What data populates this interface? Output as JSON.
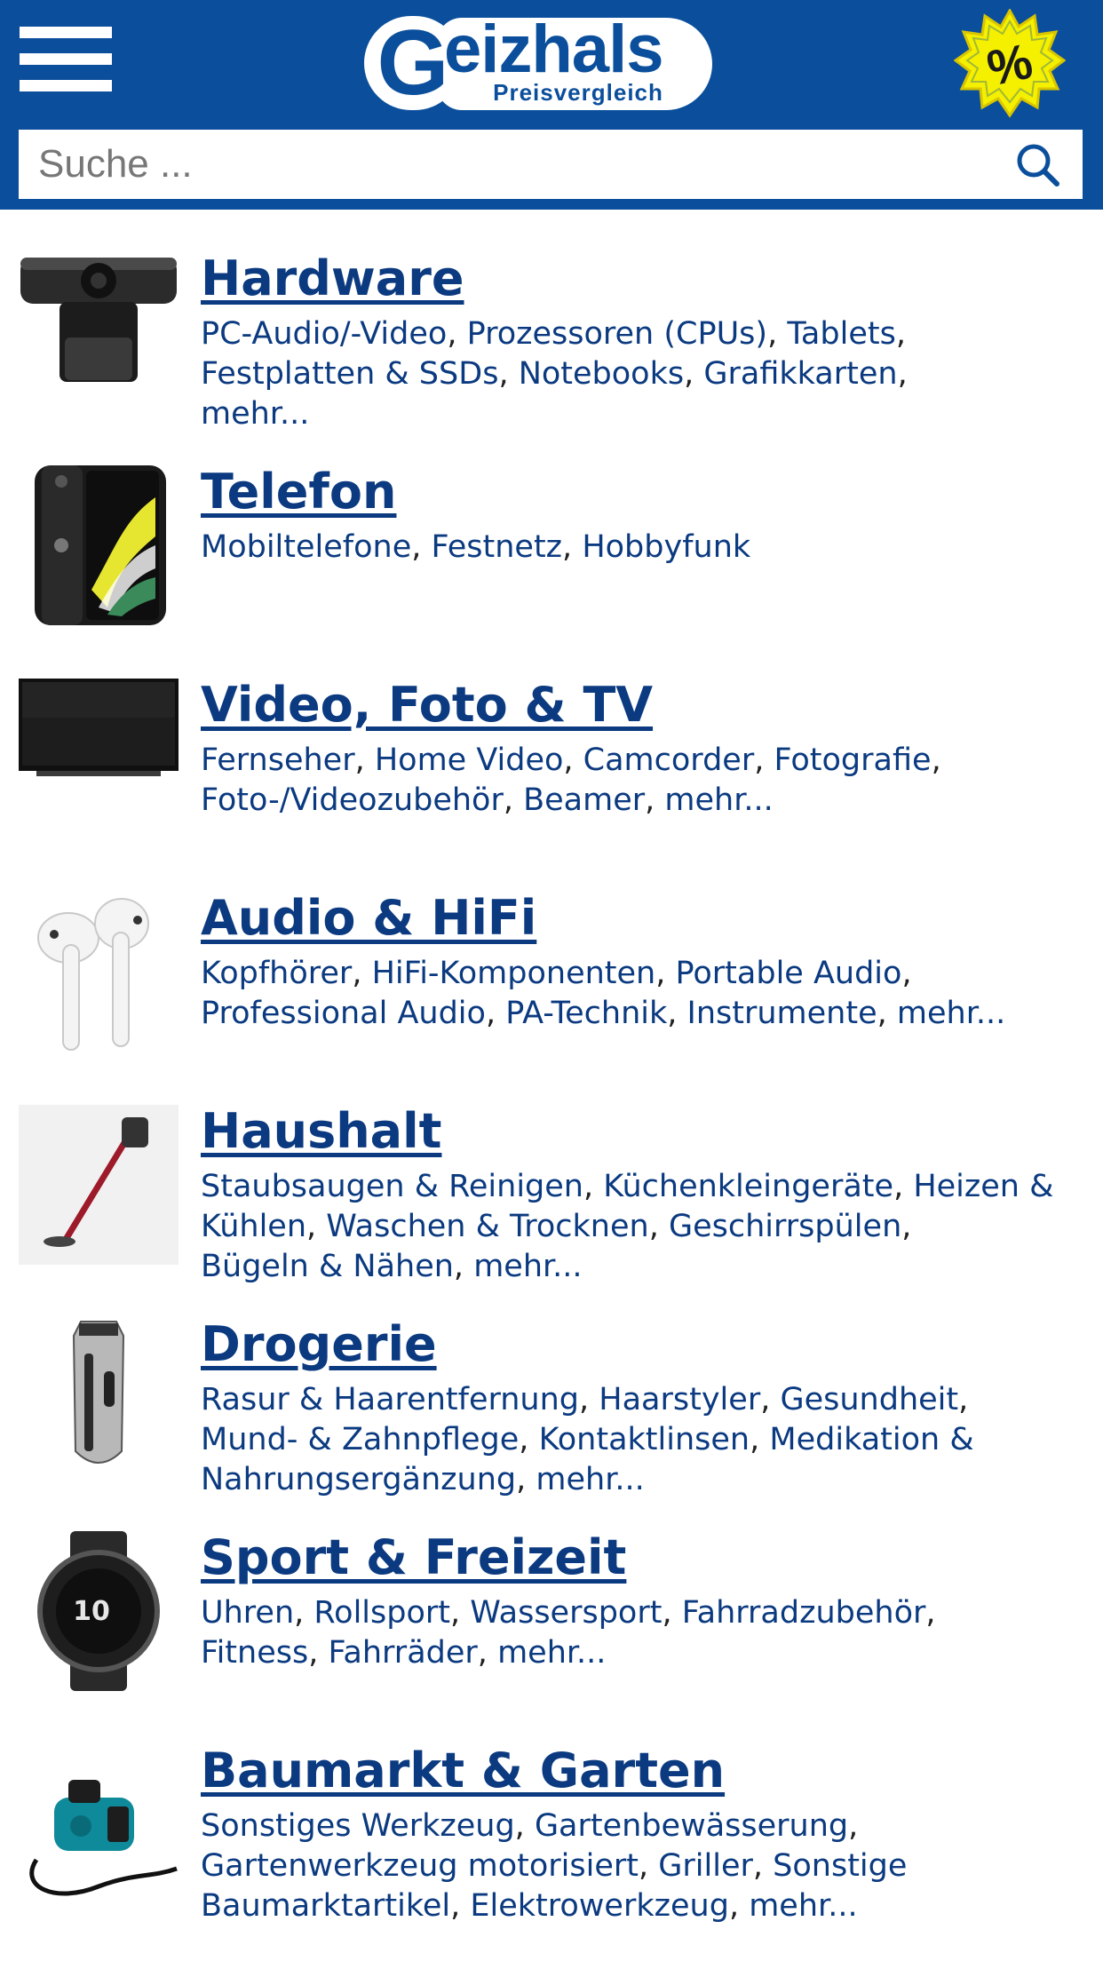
{
  "header": {
    "logo_main": "eizhals",
    "logo_letter": "G",
    "logo_sub": "Preisvergleich",
    "deals_badge": "%"
  },
  "search": {
    "placeholder": "Suche ..."
  },
  "categories": [
    {
      "title": "Hardware",
      "thumb": "webcam",
      "links": [
        "PC-Audio/-Video",
        "Prozessoren (CPUs)",
        "Tablets",
        "Festplatten & SSDs",
        "Notebooks",
        "Grafikkarten",
        "mehr..."
      ]
    },
    {
      "title": "Telefon",
      "thumb": "smartphone",
      "links": [
        "Mobiltelefone",
        "Festnetz",
        "Hobbyfunk"
      ]
    },
    {
      "title": "Video, Foto & TV",
      "thumb": "television",
      "links": [
        "Fernseher",
        "Home Video",
        "Camcorder",
        "Fotografie",
        "Foto-/Videozubehör",
        "Beamer",
        "mehr..."
      ]
    },
    {
      "title": "Audio & HiFi",
      "thumb": "earbuds",
      "links": [
        "Kopfhörer",
        "HiFi-Komponenten",
        "Portable Audio",
        "Professional Audio",
        "PA-Technik",
        "Instrumente",
        "mehr..."
      ]
    },
    {
      "title": "Haushalt",
      "thumb": "stick-vacuum",
      "links": [
        "Staubsaugen & Reinigen",
        "Küchenkleingeräte",
        "Heizen & Kühlen",
        "Waschen & Trocknen",
        "Geschirrspülen",
        "Bügeln & Nähen",
        "mehr..."
      ]
    },
    {
      "title": "Drogerie",
      "thumb": "hair-clipper",
      "links": [
        "Rasur & Haarentfernung",
        "Haarstyler",
        "Gesundheit",
        "Mund- & Zahnpflege",
        "Kontaktlinsen",
        "Medikation & Nahrungsergänzung",
        "mehr..."
      ]
    },
    {
      "title": "Sport & Freizeit",
      "thumb": "smartwatch",
      "links": [
        "Uhren",
        "Rollsport",
        "Wassersport",
        "Fahrradzubehör",
        "Fitness",
        "Fahrräder",
        "mehr..."
      ]
    },
    {
      "title": "Baumarkt & Garten",
      "thumb": "air-compressor",
      "links": [
        "Sonstiges Werkzeug",
        "Gartenbewässerung",
        "Gartenwerkzeug motorisiert",
        "Griller",
        "Sonstige Baumarktartikel",
        "Elektrowerkzeug",
        "mehr..."
      ]
    }
  ],
  "colors": {
    "header_bg": "#0b4f9c",
    "link": "#0b3a80",
    "badge": "#f4f000"
  }
}
